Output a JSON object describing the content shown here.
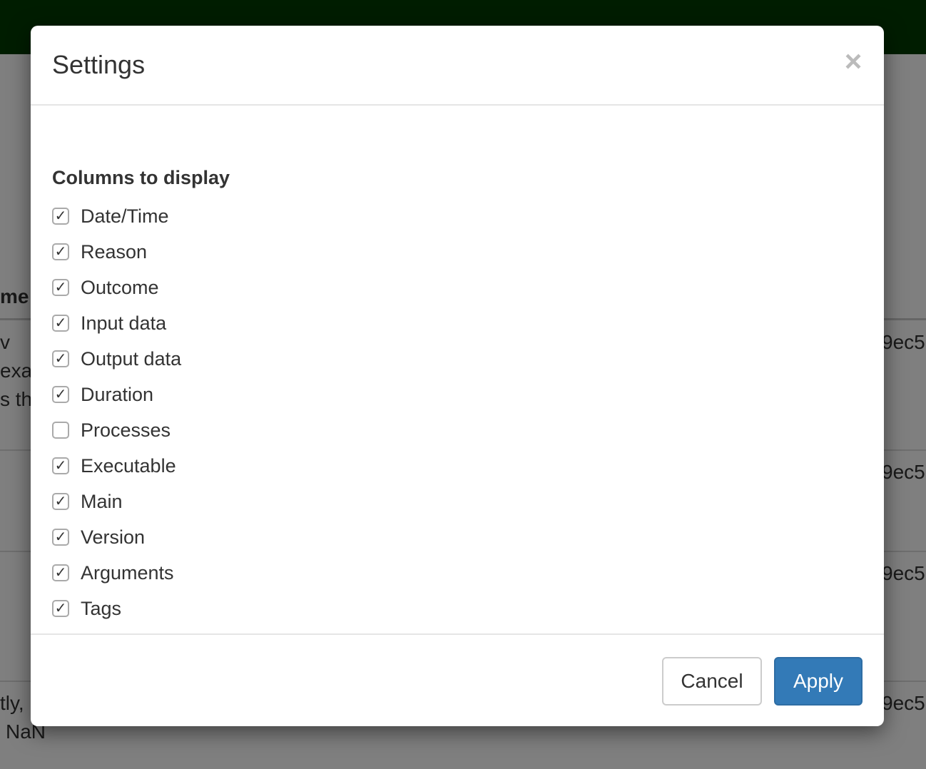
{
  "background": {
    "navbar_color": "#003b00",
    "fragments": {
      "header_cell": "me",
      "left_row1_a": "v",
      "left_row1_b": "exac",
      "left_row1_c": "s th",
      "left_row4_a": "tly,",
      "left_row4_b": "NaN",
      "right_row1": "9ec5",
      "right_row2": "9ec5",
      "right_row3": "9ec5",
      "right_row4": "9ec5"
    }
  },
  "modal": {
    "title": "Settings",
    "close_symbol": "×",
    "section_label": "Columns to display",
    "columns": [
      {
        "label": "Date/Time",
        "checked": true
      },
      {
        "label": "Reason",
        "checked": true
      },
      {
        "label": "Outcome",
        "checked": true
      },
      {
        "label": "Input data",
        "checked": true
      },
      {
        "label": "Output data",
        "checked": true
      },
      {
        "label": "Duration",
        "checked": true
      },
      {
        "label": "Processes",
        "checked": false
      },
      {
        "label": "Executable",
        "checked": true
      },
      {
        "label": "Main",
        "checked": true
      },
      {
        "label": "Version",
        "checked": true
      },
      {
        "label": "Arguments",
        "checked": true
      },
      {
        "label": "Tags",
        "checked": true
      }
    ],
    "check_mark": "✓",
    "cancel_label": "Cancel",
    "apply_label": "Apply",
    "apply_color": "#337ab7"
  }
}
